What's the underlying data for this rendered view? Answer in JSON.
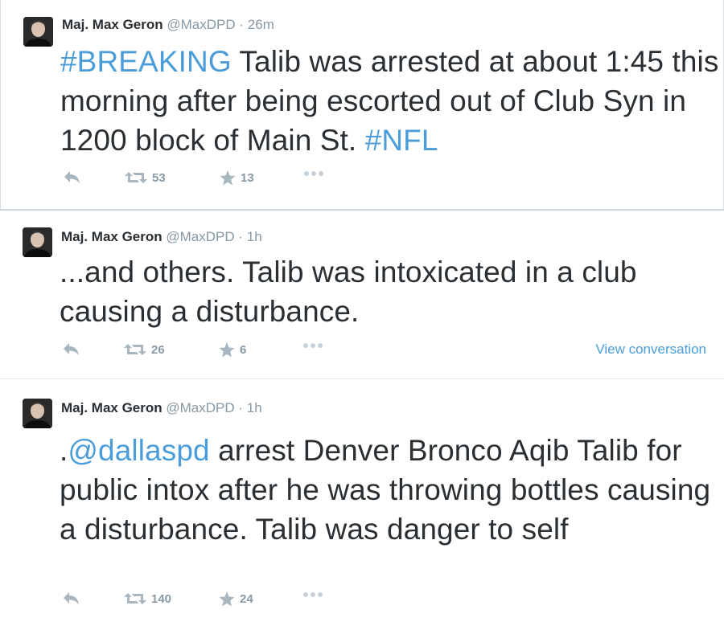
{
  "tweets": [
    {
      "fullname": "Maj. Max Geron",
      "screen_name": "@MaxDPD",
      "separator": "·",
      "time": "26m",
      "text": [
        {
          "type": "hashtag",
          "value": "#BREAKING"
        },
        {
          "type": "text",
          "value": " Talib was arrested at about 1:45 this morning after being escorted out of Club Syn in 1200 block of Main St. "
        },
        {
          "type": "hashtag",
          "value": "#NFL"
        }
      ],
      "retweets": "53",
      "favorites": "13",
      "view_conversation": ""
    },
    {
      "fullname": "Maj. Max Geron",
      "screen_name": "@MaxDPD",
      "separator": "·",
      "time": "1h",
      "text": [
        {
          "type": "text",
          "value": "...and others. Talib was intoxicated in a club causing a disturbance."
        }
      ],
      "retweets": "26",
      "favorites": "6",
      "view_conversation": "View conversation"
    },
    {
      "fullname": "Maj. Max Geron",
      "screen_name": "@MaxDPD",
      "separator": "·",
      "time": "1h",
      "text": [
        {
          "type": "text",
          "value": "."
        },
        {
          "type": "mention",
          "value": "@dallaspd"
        },
        {
          "type": "text",
          "value": " arrest Denver Bronco Aqib Talib for public intox after he was throwing bottles causing a disturbance. Talib was danger to self"
        }
      ],
      "retweets": "140",
      "favorites": "24",
      "view_conversation": ""
    }
  ],
  "icons": {
    "reply": "reply-icon",
    "retweet": "retweet-icon",
    "favorite": "star-icon",
    "more": "more-icon",
    "avatar": "avatar"
  },
  "colors": {
    "link": "#4a9dd8",
    "text": "#292f33",
    "muted": "#8899a6",
    "icon": "#a8b6c0"
  }
}
